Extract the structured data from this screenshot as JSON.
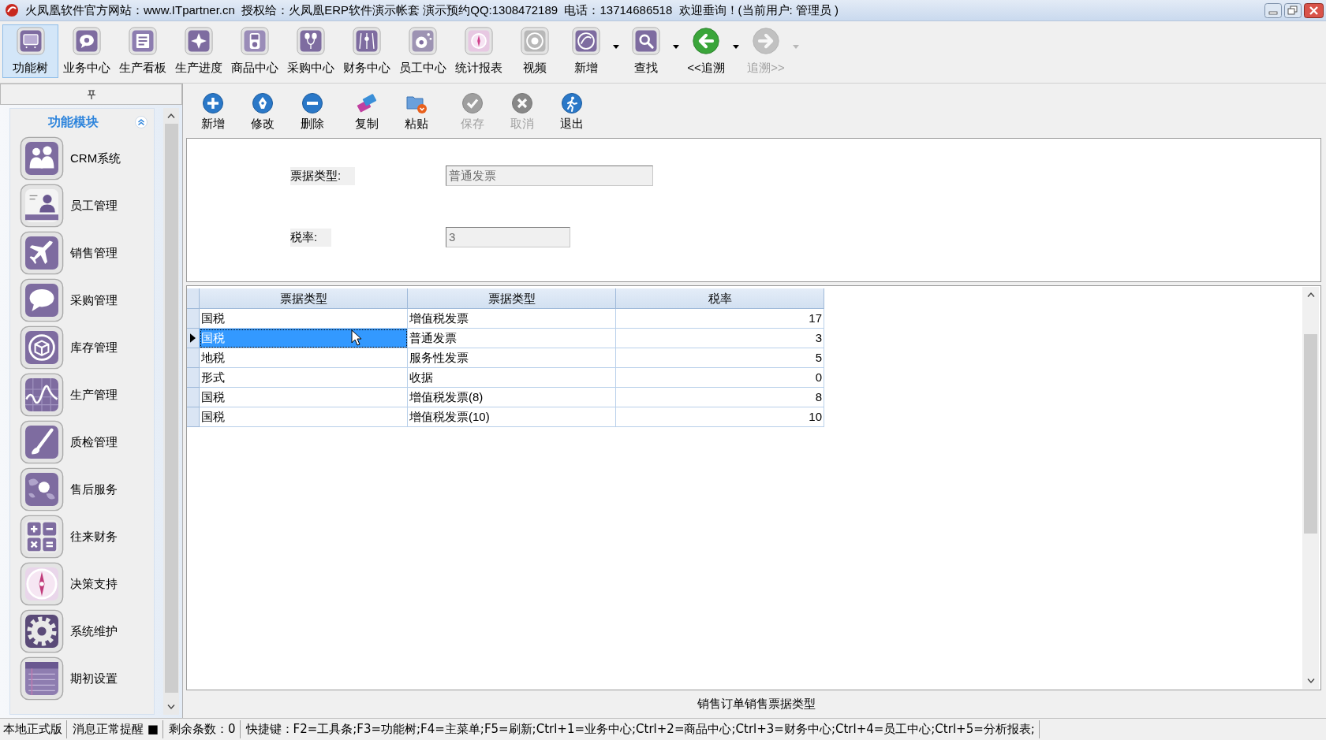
{
  "window": {
    "title": "火凤凰软件官方网站：www.ITpartner.cn  授权给：火凤凰ERP软件演示帐套 演示预约QQ:1308472189  电话：13714686518  欢迎垂询！(当前用户: 管理员 )"
  },
  "main_toolbar": [
    {
      "label": "功能树",
      "selected": true,
      "disabled": false,
      "has_menu": false
    },
    {
      "label": "业务中心",
      "selected": false,
      "disabled": false,
      "has_menu": false
    },
    {
      "label": "生产看板",
      "selected": false,
      "disabled": false,
      "has_menu": false
    },
    {
      "label": "生产进度",
      "selected": false,
      "disabled": false,
      "has_menu": false
    },
    {
      "label": "商品中心",
      "selected": false,
      "disabled": false,
      "has_menu": false
    },
    {
      "label": "采购中心",
      "selected": false,
      "disabled": false,
      "has_menu": false
    },
    {
      "label": "财务中心",
      "selected": false,
      "disabled": false,
      "has_menu": false
    },
    {
      "label": "员工中心",
      "selected": false,
      "disabled": false,
      "has_menu": false
    },
    {
      "label": "统计报表",
      "selected": false,
      "disabled": false,
      "has_menu": false
    },
    {
      "label": "视频",
      "selected": false,
      "disabled": false,
      "has_menu": false
    },
    {
      "label": "新增",
      "selected": false,
      "disabled": false,
      "has_menu": true
    },
    {
      "label": "查找",
      "selected": false,
      "disabled": false,
      "has_menu": true
    },
    {
      "label": "<<追溯",
      "selected": false,
      "disabled": false,
      "has_menu": true
    },
    {
      "label": "追溯>>",
      "selected": false,
      "disabled": true,
      "has_menu": true
    }
  ],
  "side_panel": {
    "title": "功能模块",
    "expanded": true,
    "items": [
      {
        "label": "CRM系统"
      },
      {
        "label": "员工管理"
      },
      {
        "label": "销售管理"
      },
      {
        "label": "采购管理"
      },
      {
        "label": "库存管理"
      },
      {
        "label": "生产管理"
      },
      {
        "label": "质检管理"
      },
      {
        "label": "售后服务"
      },
      {
        "label": "往来财务"
      },
      {
        "label": "决策支持"
      },
      {
        "label": "系统维护"
      },
      {
        "label": "期初设置"
      }
    ]
  },
  "edit_toolbar": [
    {
      "label": "新增",
      "disabled": false
    },
    {
      "label": "修改",
      "disabled": false
    },
    {
      "label": "删除",
      "disabled": false
    },
    {
      "label": "复制",
      "disabled": false
    },
    {
      "label": "粘贴",
      "disabled": false
    },
    {
      "label": "保存",
      "disabled": true
    },
    {
      "label": "取消",
      "disabled": true
    },
    {
      "label": "退出",
      "disabled": false
    }
  ],
  "form": {
    "fields": [
      {
        "label": "票据类型:",
        "value": "普通发票",
        "disabled": true
      },
      {
        "label": "税率:",
        "value": "3",
        "disabled": true
      }
    ]
  },
  "grid": {
    "columns": [
      {
        "label": "票据类型",
        "kind": "text"
      },
      {
        "label": "票据类型",
        "kind": "text"
      },
      {
        "label": "税率",
        "kind": "number"
      }
    ],
    "rows": [
      {
        "selected": false,
        "cells": [
          "国税",
          "增值税发票",
          "17"
        ]
      },
      {
        "selected": true,
        "cells": [
          "国税",
          "普通发票",
          "3"
        ]
      },
      {
        "selected": false,
        "cells": [
          "地税",
          "服务性发票",
          "5"
        ]
      },
      {
        "selected": false,
        "cells": [
          "形式",
          "收据",
          "0"
        ]
      },
      {
        "selected": false,
        "cells": [
          "国税",
          "增值税发票(8)",
          "8"
        ]
      },
      {
        "selected": false,
        "cells": [
          "国税",
          "增值税发票(10)",
          "10"
        ]
      }
    ]
  },
  "caption": "销售订单销售票据类型",
  "status_bar": [
    "本地正式版",
    "消息正常提醒 ■",
    "剩余条数：0",
    "快捷键：F2=工具条;F3=功能树;F4=主菜单;F5=刷新;Ctrl+1=业务中心;Ctrl+2=商品中心;Ctrl+3=财务中心;Ctrl+4=员工中心;Ctrl+5=分析报表;"
  ]
}
